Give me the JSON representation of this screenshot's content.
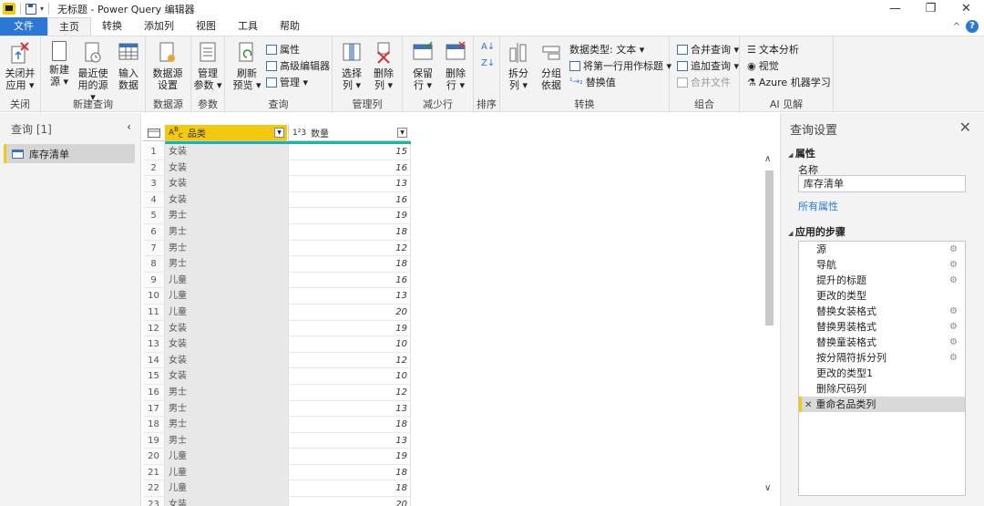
{
  "window": {
    "title": "无标题 - Power Query 编辑器",
    "controls": [
      "—",
      "❐",
      "✕"
    ]
  },
  "tabs": [
    {
      "label": "文件"
    },
    {
      "label": "主页"
    },
    {
      "label": "转换"
    },
    {
      "label": "添加列"
    },
    {
      "label": "视图"
    },
    {
      "label": "工具"
    },
    {
      "label": "帮助"
    }
  ],
  "ribbon": {
    "groups": {
      "close": "关闭",
      "new_query": "新建查询",
      "data_source": "数据源",
      "params": "参数",
      "query": "查询",
      "manage_cols": "管理列",
      "reduce_rows": "减少行",
      "sort": "排序",
      "transform": "转换",
      "combine": "组合",
      "ai": "AI 见解"
    },
    "buttons": {
      "close_apply": [
        "关闭并",
        "应用 ▾"
      ],
      "new_source": [
        "新建",
        "源 ▾"
      ],
      "recent_sources": [
        "最近使",
        "用的源 ▾"
      ],
      "enter_data": [
        "输入",
        "数据"
      ],
      "ds_settings": [
        "数据源",
        "设置"
      ],
      "manage_params": [
        "管理",
        "参数 ▾"
      ],
      "refresh_preview": [
        "刷新",
        "预览 ▾"
      ],
      "properties": "属性",
      "advanced_editor": "高级编辑器",
      "manage": "管理 ▾",
      "choose_cols": [
        "选择",
        "列 ▾"
      ],
      "remove_cols": [
        "删除",
        "列 ▾"
      ],
      "keep_rows": [
        "保留",
        "行 ▾"
      ],
      "remove_rows": [
        "删除",
        "行 ▾"
      ],
      "split_col": [
        "拆分",
        "列 ▾"
      ],
      "group_by": [
        "分组",
        "依据"
      ],
      "data_type": "数据类型: 文本 ▾",
      "first_row_headers": "将第一行用作标题 ▾",
      "replace_values": "替换值",
      "merge_queries": "合并查询 ▾",
      "append_queries": "追加查询 ▾",
      "combine_files": "合并文件",
      "text_analytics": "文本分析",
      "vision": "视觉",
      "azure_ml": "Azure 机器学习"
    }
  },
  "left_panel": {
    "title": "查询 [1]",
    "queries": [
      "库存清单"
    ]
  },
  "grid": {
    "columns": [
      {
        "type": "A^B_C",
        "name": "品类"
      },
      {
        "type": "1²3",
        "name": "数量"
      }
    ],
    "rows": [
      [
        "1",
        "女装",
        "15"
      ],
      [
        "2",
        "女装",
        "16"
      ],
      [
        "3",
        "女装",
        "13"
      ],
      [
        "4",
        "女装",
        "16"
      ],
      [
        "5",
        "男士",
        "19"
      ],
      [
        "6",
        "男士",
        "18"
      ],
      [
        "7",
        "男士",
        "12"
      ],
      [
        "8",
        "男士",
        "18"
      ],
      [
        "9",
        "儿童",
        "16"
      ],
      [
        "10",
        "儿童",
        "13"
      ],
      [
        "11",
        "儿童",
        "20"
      ],
      [
        "12",
        "女装",
        "19"
      ],
      [
        "13",
        "女装",
        "10"
      ],
      [
        "14",
        "女装",
        "12"
      ],
      [
        "15",
        "女装",
        "10"
      ],
      [
        "16",
        "男士",
        "12"
      ],
      [
        "17",
        "男士",
        "13"
      ],
      [
        "18",
        "男士",
        "18"
      ],
      [
        "19",
        "男士",
        "13"
      ],
      [
        "20",
        "儿童",
        "19"
      ],
      [
        "21",
        "儿童",
        "18"
      ],
      [
        "22",
        "儿童",
        "18"
      ],
      [
        "23",
        "女装",
        "20"
      ]
    ]
  },
  "right_panel": {
    "title": "查询设置",
    "properties_header": "属性",
    "name_label": "名称",
    "name_value": "库存清单",
    "all_properties_link": "所有属性",
    "steps_header": "应用的步骤",
    "steps": [
      {
        "label": "源",
        "gear": true
      },
      {
        "label": "导航",
        "gear": true
      },
      {
        "label": "提升的标题",
        "gear": true
      },
      {
        "label": "更改的类型",
        "gear": false
      },
      {
        "label": "替换女装格式",
        "gear": true
      },
      {
        "label": "替换男装格式",
        "gear": true
      },
      {
        "label": "替换童装格式",
        "gear": true
      },
      {
        "label": "按分隔符拆分列",
        "gear": true
      },
      {
        "label": "更改的类型1",
        "gear": false
      },
      {
        "label": "删除尺码列",
        "gear": false
      },
      {
        "label": "重命名品类列",
        "gear": false,
        "selected": true
      }
    ]
  },
  "colors": {
    "accent": "#2b78d4",
    "header_highlight": "#f2c811",
    "quality_bar": "#1fb5a6"
  }
}
